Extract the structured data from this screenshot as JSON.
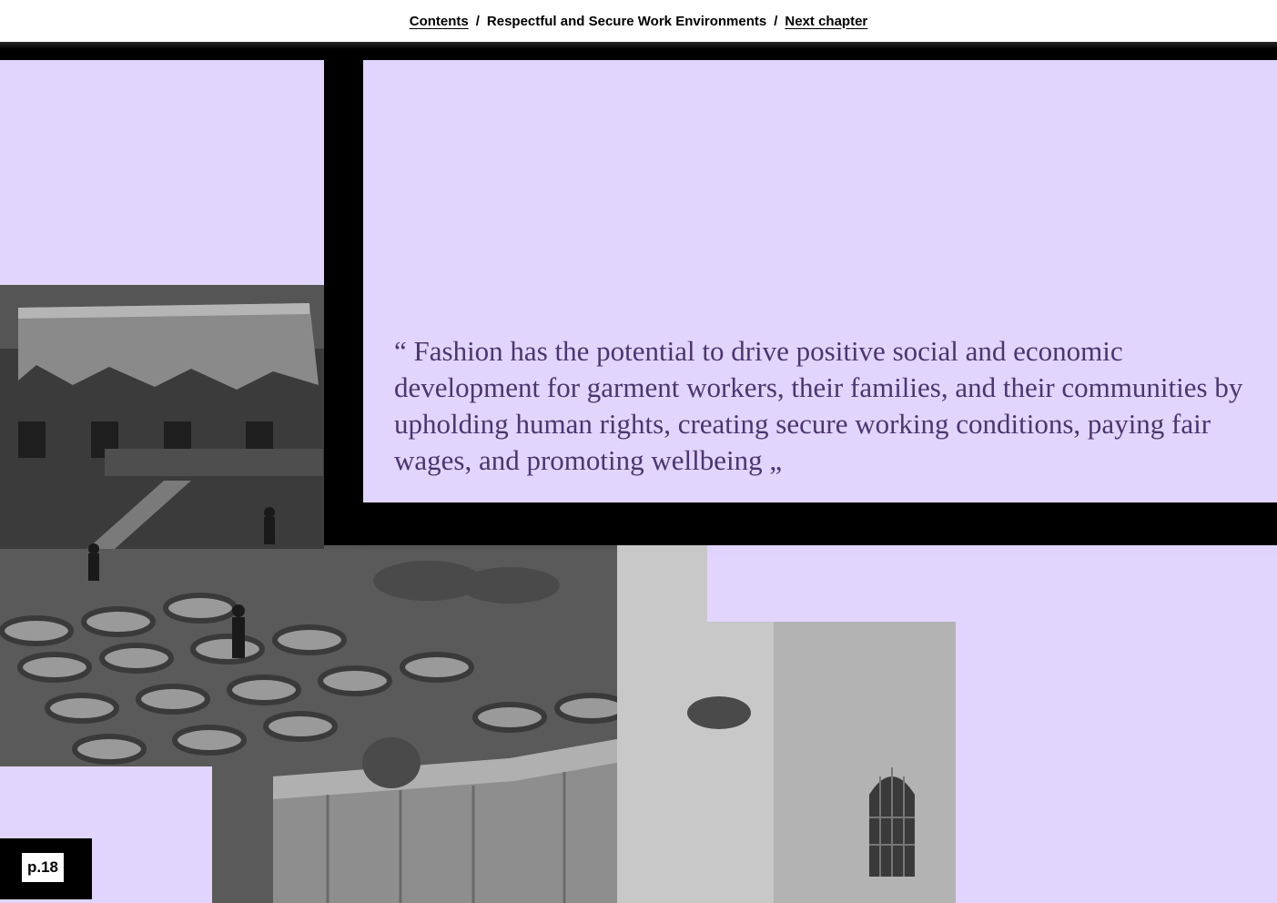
{
  "nav": {
    "contents_label": "Contents",
    "separator": "/",
    "chapter_title": "Respectful and Secure Work Environments",
    "next_label": "Next chapter"
  },
  "quote": {
    "text": "“ Fashion has the potential to drive positive social and economic development for garment workers, their families, and their communities by upholding human rights, creating secure working conditions, paying fair wages, and promoting wellbeing „"
  },
  "page": {
    "label": "p.18"
  },
  "colors": {
    "lavender": "#e1d5fe",
    "quote_text": "#4b3570",
    "frame": "#000000"
  }
}
